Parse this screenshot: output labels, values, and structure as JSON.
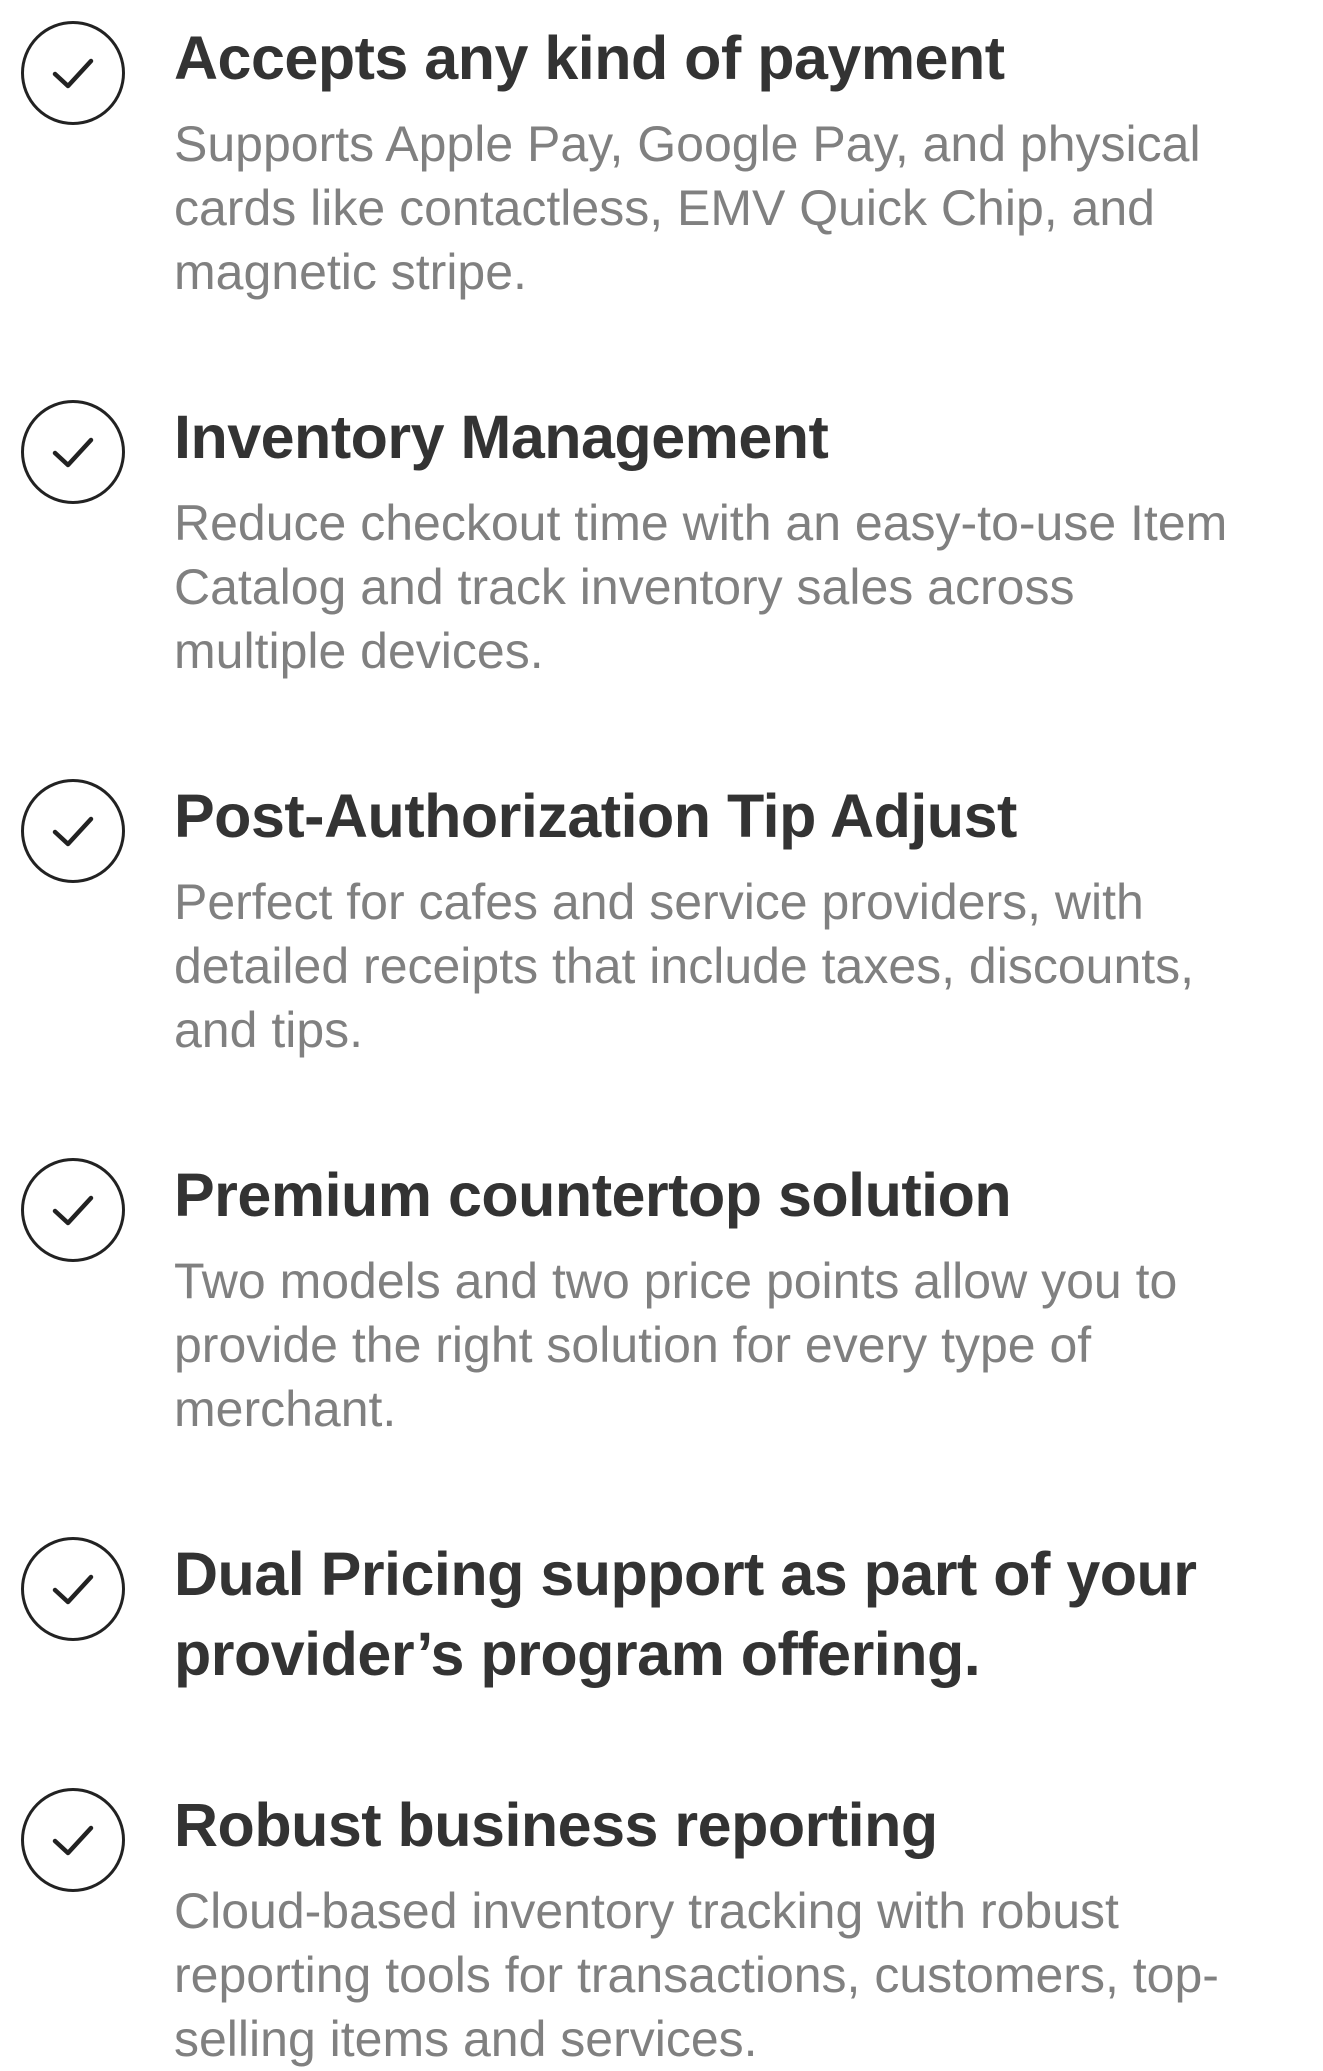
{
  "features": [
    {
      "title": "Accepts any kind of payment",
      "description_lines": [
        "Supports Apple Pay, Google Pay, and physical",
        "cards like contactless, EMV Quick Chip, and",
        "magnetic stripe."
      ]
    },
    {
      "title": "Inventory Management",
      "description_lines": [
        "Reduce checkout time with an easy-to-use Item",
        "Catalog and track inventory sales across",
        "multiple devices."
      ]
    },
    {
      "title": "Post-Authorization Tip Adjust",
      "description_lines": [
        "Perfect for cafes and service providers, with",
        "detailed receipts that include taxes, discounts,",
        "and tips."
      ]
    },
    {
      "title": "Premium countertop solution",
      "description_lines": [
        "Two models and two price points allow you to",
        "provide the right solution for every type of",
        "merchant."
      ]
    },
    {
      "title_lines": [
        "Dual Pricing support as part of your",
        "provider’s program offering."
      ]
    },
    {
      "title": "Robust business reporting",
      "description_lines": [
        "Cloud-based inventory tracking with robust",
        "reporting tools for transactions, customers, top-",
        "selling items and services."
      ]
    }
  ],
  "icons": {
    "check": "check-circle-icon"
  },
  "colors": {
    "title": "#333333",
    "description": "#808080",
    "icon_stroke": "#222222",
    "background": "#ffffff"
  }
}
